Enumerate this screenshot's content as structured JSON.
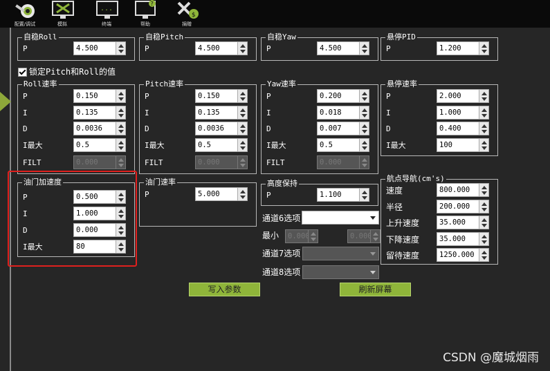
{
  "toolbar": {
    "items": [
      {
        "label": "配置/调试",
        "icon": "gear-icon"
      },
      {
        "label": "模拟",
        "icon": "monitor-icon"
      },
      {
        "label": "终端",
        "icon": "terminal-icon"
      },
      {
        "label": "帮助",
        "icon": "help-icon"
      },
      {
        "label": "捐赠",
        "icon": "donate-icon"
      }
    ]
  },
  "stabilize_roll": {
    "title": "自稳Roll",
    "p_label": "P",
    "p": "4.500"
  },
  "stabilize_pitch": {
    "title": "自稳Pitch",
    "p_label": "P",
    "p": "4.500"
  },
  "stabilize_yaw": {
    "title": "自稳Yaw",
    "p_label": "P",
    "p": "4.500"
  },
  "hover_pid": {
    "title": "悬停PID",
    "p_label": "P",
    "p": "1.200"
  },
  "lock_pitch_roll": {
    "label": "锁定Pitch和Roll的值",
    "checked": true
  },
  "rate_roll": {
    "title": "Roll速率",
    "p_label": "P",
    "p": "0.150",
    "i_label": "I",
    "i": "0.135",
    "d_label": "D",
    "d": "0.0036",
    "imax_label": "I最大",
    "imax": "0.5",
    "filt_label": "FILT",
    "filt": "0.000"
  },
  "rate_pitch": {
    "title": "Pitch速率",
    "p_label": "P",
    "p": "0.150",
    "i_label": "I",
    "i": "0.135",
    "d_label": "D",
    "d": "0.0036",
    "imax_label": "I最大",
    "imax": "0.5",
    "filt_label": "FILT",
    "filt": "0.000"
  },
  "rate_yaw": {
    "title": "Yaw速率",
    "p_label": "P",
    "p": "0.200",
    "i_label": "I",
    "i": "0.018",
    "d_label": "D",
    "d": "0.007",
    "imax_label": "I最大",
    "imax": "0.5",
    "filt_label": "FILT",
    "filt": "0.000"
  },
  "hover_rate": {
    "title": "悬停速率",
    "p_label": "P",
    "p": "2.000",
    "i_label": "I",
    "i": "1.000",
    "d_label": "D",
    "d": "0.400",
    "imax_label": "I最大",
    "imax": "100"
  },
  "throttle_accel": {
    "title": "油门加速度",
    "p_label": "P",
    "p": "0.500",
    "i_label": "I",
    "i": "1.000",
    "d_label": "D",
    "d": "0.000",
    "imax_label": "I最大",
    "imax": "80"
  },
  "throttle_rate": {
    "title": "油门速率",
    "p_label": "P",
    "p": "5.000"
  },
  "altitude_hold": {
    "title": "高度保持",
    "p_label": "P",
    "p": "1.100"
  },
  "channel6": {
    "label": "通道6选项",
    "min_label": "最小",
    "min": "0.000",
    "max": "0.000"
  },
  "channel7": {
    "label": "通道7选项"
  },
  "channel8": {
    "label": "通道8选项"
  },
  "waypoint_nav": {
    "title": "航点导航(cm's)",
    "speed_label": "速度",
    "speed": "800.000",
    "radius_label": "半径",
    "radius": "200.000",
    "climb_label": "上升速度",
    "climb": "35.000",
    "descent_label": "下降速度",
    "descent": "35.000",
    "loiter_label": "留待速度",
    "loiter": "1250.000"
  },
  "buttons": {
    "write": "写入参数",
    "refresh": "刷新屏幕"
  },
  "watermark": "CSDN @魔城烟雨",
  "colors": {
    "accent_green": "#8fb53a",
    "highlight_red": "#e0201e",
    "background": "#262626"
  }
}
